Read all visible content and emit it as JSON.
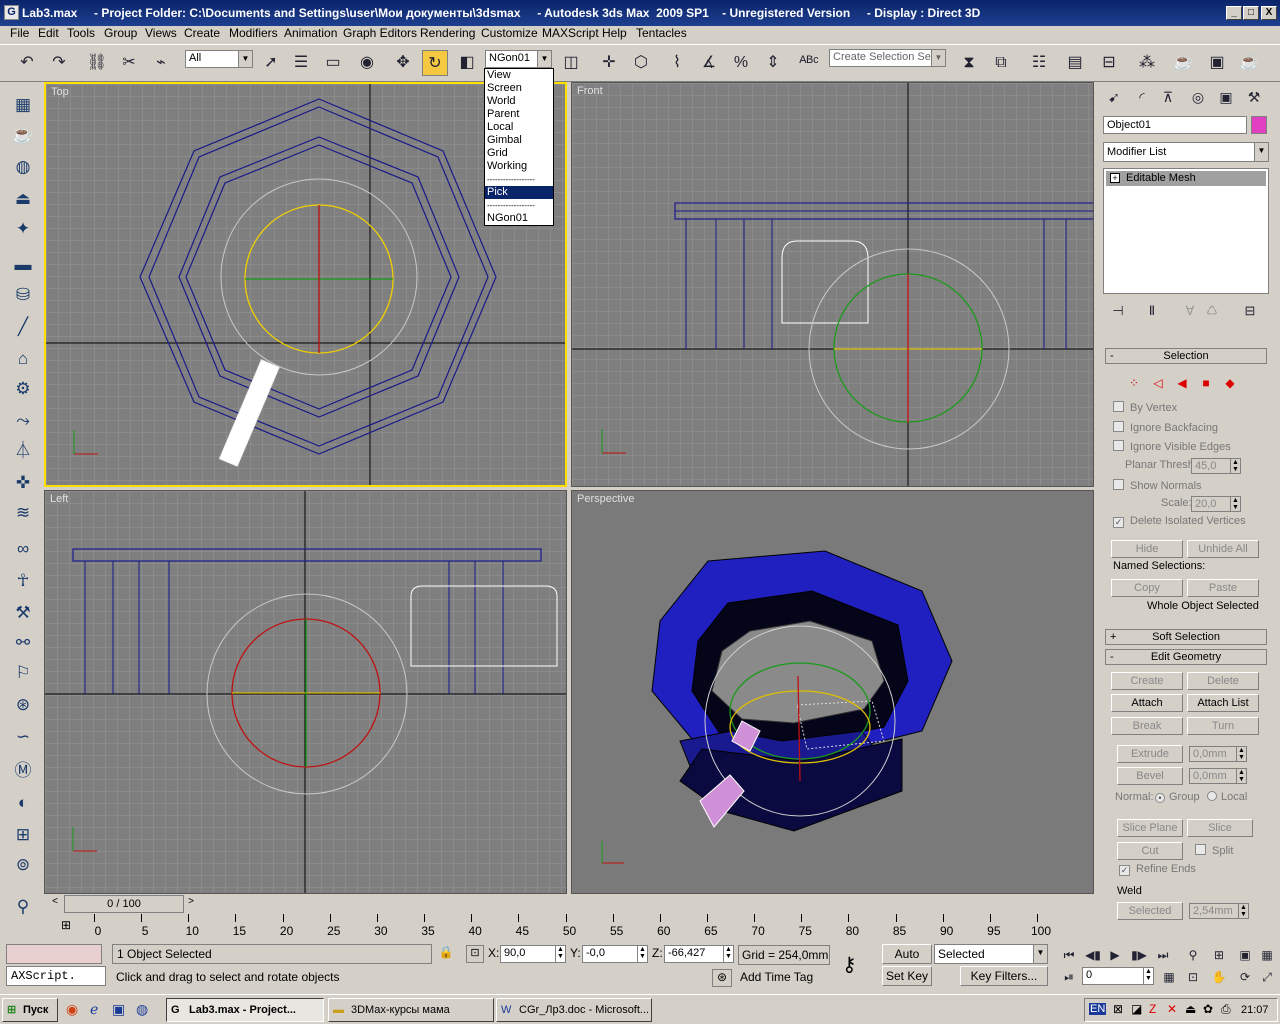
{
  "window": {
    "title": "Lab3.max     - Project Folder: C:\\Documents and Settings\\user\\Мои документы\\3dsmax     - Autodesk 3ds Max  2009 SP1    - Unregistered Version     - Display : Direct 3D",
    "app_icon": "3dsmax-logo-icon",
    "controls": [
      "_",
      "□",
      "X"
    ]
  },
  "menu": [
    "File",
    "Edit",
    "Tools",
    "Group",
    "Views",
    "Create",
    "Modifiers",
    "Animation",
    "Graph Editors",
    "Rendering",
    "Customize",
    "MAXScript",
    "Help",
    "Tentacles"
  ],
  "toolbar": {
    "selection_filter": "All",
    "reference_coord": "NGon01",
    "named_selection_placeholder": "Create Selection Set"
  },
  "coord_dropdown": {
    "items": [
      "View",
      "Screen",
      "World",
      "Parent",
      "Local",
      "Gimbal",
      "Grid",
      "Working",
      "------------------",
      "Pick",
      "------------------",
      "NGon01"
    ],
    "selected": "Pick"
  },
  "viewports": {
    "top": "Top",
    "front": "Front",
    "left": "Left",
    "perspective": "Perspective"
  },
  "command_panel": {
    "object_name": "Object01",
    "object_color": "#e040c0",
    "modifier_list": "Modifier List",
    "stack_item": "Editable Mesh",
    "selection": {
      "header": "Selection",
      "by_vertex": "By Vertex",
      "ignore_backfacing": "Ignore Backfacing",
      "ignore_visible_edges": "Ignore Visible Edges",
      "planar_thresh_label": "Planar Thresh:",
      "planar_thresh": "45,0",
      "show_normals": "Show Normals",
      "scale_label": "Scale:",
      "scale": "20,0",
      "delete_isolated": "Delete Isolated Vertices",
      "hide": "Hide",
      "unhide_all": "Unhide All",
      "named_selections": "Named Selections:",
      "copy": "Copy",
      "paste": "Paste",
      "status": "Whole Object Selected"
    },
    "soft_selection": "Soft Selection",
    "edit_geometry": {
      "header": "Edit Geometry",
      "create": "Create",
      "delete": "Delete",
      "attach": "Attach",
      "attach_list": "Attach List",
      "break": "Break",
      "turn": "Turn",
      "extrude": "Extrude",
      "extrude_val": "0,0mm",
      "bevel": "Bevel",
      "bevel_val": "0,0mm",
      "normal_label": "Normal:",
      "group": "Group",
      "local": "Local",
      "slice_plane": "Slice Plane",
      "slice": "Slice",
      "cut": "Cut",
      "split": "Split",
      "refine_ends": "Refine Ends",
      "weld_label": "Weld",
      "selected": "Selected",
      "weld_val": "2,54mm"
    }
  },
  "timeline": {
    "frame": "0 / 100",
    "ticks": [
      "0",
      "5",
      "10",
      "15",
      "20",
      "25",
      "30",
      "35",
      "40",
      "45",
      "50",
      "55",
      "60",
      "65",
      "70",
      "75",
      "80",
      "85",
      "90",
      "95",
      "100"
    ]
  },
  "status": {
    "maxscript": "AXScript.",
    "selected_text": "1 Object Selected",
    "prompt": "Click and drag to select and rotate objects",
    "x_label": "X:",
    "x": "90,0",
    "y_label": "Y:",
    "y": "-0,0",
    "z_label": "Z:",
    "z": "-66,427",
    "grid": "Grid = 254,0mm",
    "add_time_tag": "Add Time Tag",
    "auto_key": "Auto Key",
    "set_key": "Set Key",
    "key_mode": "Selected",
    "key_filters": "Key Filters...",
    "current_frame": "0"
  },
  "taskbar": {
    "start": "Пуск",
    "tasks": [
      "Lab3.max      - Project...",
      "3DMax-курсы мама",
      "CGr_Лр3.doc - Microsoft..."
    ],
    "lang": "EN",
    "clock": "21:07"
  }
}
